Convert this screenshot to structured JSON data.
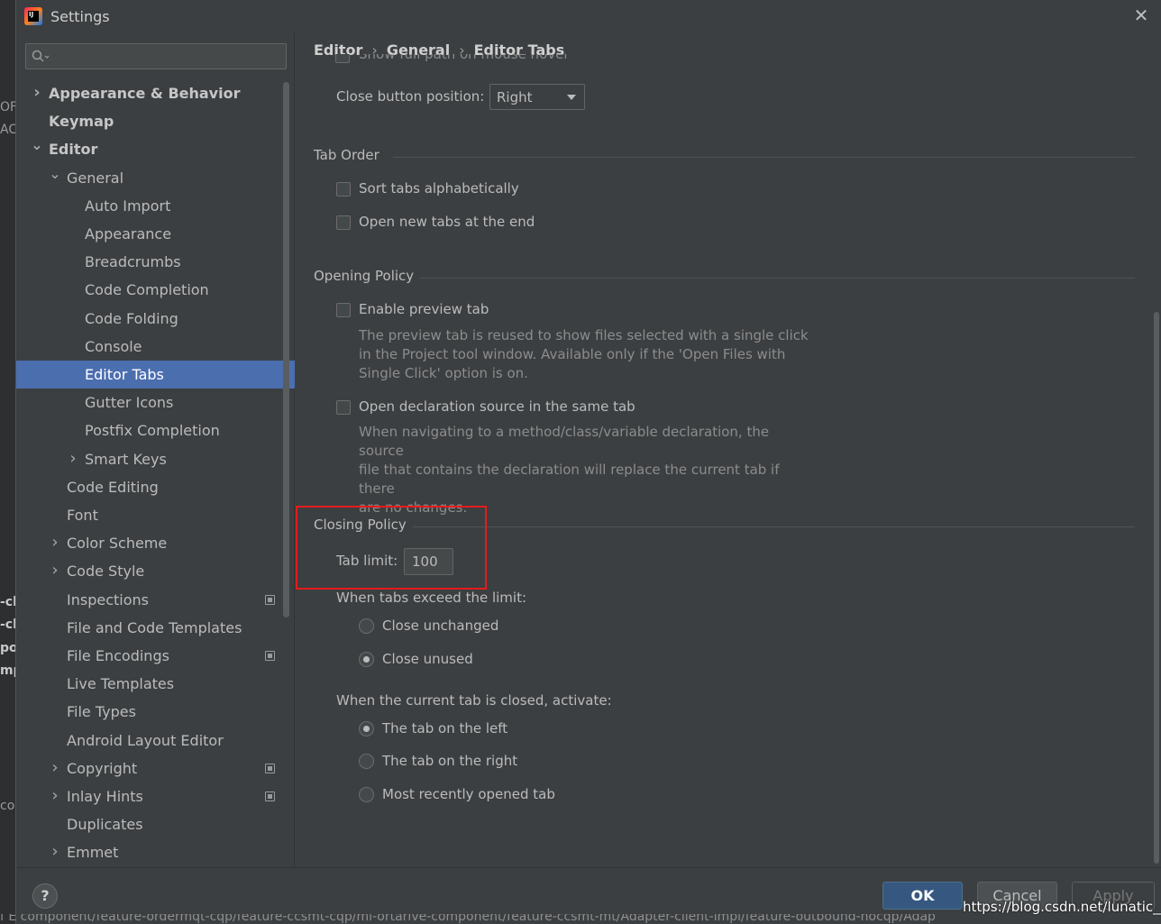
{
  "window": {
    "title": "Settings"
  },
  "background": {
    "left_fragments": [
      "OF",
      "ACI",
      "-cli",
      "-cli",
      "por",
      "mp",
      "cor"
    ],
    "bottom_strip": "f E component/feature-ordermqt-cqp/feature-ccsmt-cqp/mi-ortarive-component/feature-ccsmt-mt/Adapter-client-impl/feature-outbound-nocqp/Adap"
  },
  "search": {
    "placeholder": ""
  },
  "sidebar": {
    "items": [
      {
        "label": "Appearance & Behavior",
        "level": 0,
        "chevron": "right",
        "bold": true
      },
      {
        "label": "Keymap",
        "level": 0,
        "chevron": "",
        "bold": true
      },
      {
        "label": "Editor",
        "level": 0,
        "chevron": "down",
        "bold": true
      },
      {
        "label": "General",
        "level": 1,
        "chevron": "down"
      },
      {
        "label": "Auto Import",
        "level": 2,
        "chevron": ""
      },
      {
        "label": "Appearance",
        "level": 2,
        "chevron": ""
      },
      {
        "label": "Breadcrumbs",
        "level": 2,
        "chevron": ""
      },
      {
        "label": "Code Completion",
        "level": 2,
        "chevron": ""
      },
      {
        "label": "Code Folding",
        "level": 2,
        "chevron": ""
      },
      {
        "label": "Console",
        "level": 2,
        "chevron": ""
      },
      {
        "label": "Editor Tabs",
        "level": 2,
        "chevron": "",
        "selected": true
      },
      {
        "label": "Gutter Icons",
        "level": 2,
        "chevron": ""
      },
      {
        "label": "Postfix Completion",
        "level": 2,
        "chevron": ""
      },
      {
        "label": "Smart Keys",
        "level": 2,
        "chevron": "right"
      },
      {
        "label": "Code Editing",
        "level": 1,
        "chevron": ""
      },
      {
        "label": "Font",
        "level": 1,
        "chevron": ""
      },
      {
        "label": "Color Scheme",
        "level": 1,
        "chevron": "right"
      },
      {
        "label": "Code Style",
        "level": 1,
        "chevron": "right"
      },
      {
        "label": "Inspections",
        "level": 1,
        "chevron": "",
        "project_icon": true
      },
      {
        "label": "File and Code Templates",
        "level": 1,
        "chevron": ""
      },
      {
        "label": "File Encodings",
        "level": 1,
        "chevron": "",
        "project_icon": true
      },
      {
        "label": "Live Templates",
        "level": 1,
        "chevron": ""
      },
      {
        "label": "File Types",
        "level": 1,
        "chevron": ""
      },
      {
        "label": "Android Layout Editor",
        "level": 1,
        "chevron": ""
      },
      {
        "label": "Copyright",
        "level": 1,
        "chevron": "right",
        "project_icon": true
      },
      {
        "label": "Inlay Hints",
        "level": 1,
        "chevron": "right",
        "project_icon": true
      },
      {
        "label": "Duplicates",
        "level": 1,
        "chevron": ""
      },
      {
        "label": "Emmet",
        "level": 1,
        "chevron": "right"
      }
    ]
  },
  "breadcrumb": [
    "Editor",
    "General",
    "Editor Tabs"
  ],
  "content": {
    "cut_off_option": "Show full path on mouse hover",
    "close_button_position": {
      "label": "Close button position:",
      "value": "Right"
    },
    "tab_order": {
      "title": "Tab Order",
      "sort_alpha": {
        "label": "Sort tabs alphabetically",
        "checked": false
      },
      "open_at_end": {
        "label": "Open new tabs at the end",
        "checked": false
      }
    },
    "opening_policy": {
      "title": "Opening Policy",
      "preview_tab": {
        "label": "Enable preview tab",
        "checked": false,
        "desc_lines": [
          "The preview tab is reused to show files selected with a single click",
          "in the Project tool window. Available only if the 'Open Files with",
          "Single Click' option is on."
        ]
      },
      "declaration_same_tab": {
        "label": "Open declaration source in the same tab",
        "checked": false,
        "desc_lines": [
          "When navigating to a method/class/variable declaration, the source",
          "file that contains the declaration will replace the current tab if there",
          "are no changes."
        ]
      }
    },
    "closing_policy": {
      "title": "Closing Policy",
      "tab_limit_label": "Tab limit:",
      "tab_limit_value": "100",
      "exceed_label": "When tabs exceed the limit:",
      "exceed_options": [
        {
          "label": "Close unchanged",
          "checked": false
        },
        {
          "label": "Close unused",
          "checked": true
        }
      ],
      "activate_label": "When the current tab is closed, activate:",
      "activate_options": [
        {
          "label": "The tab on the left",
          "checked": true
        },
        {
          "label": "The tab on the right",
          "checked": false
        },
        {
          "label": "Most recently opened tab",
          "checked": false
        }
      ]
    }
  },
  "footer": {
    "help": "?",
    "ok": "OK",
    "cancel": "Cancel",
    "apply": "Apply",
    "watermark": "https://blog.csdn.net/lunatic__"
  },
  "colors": {
    "selection": "#4b6eaf",
    "highlight_box": "#e51b1b",
    "ok_button": "#365880"
  }
}
